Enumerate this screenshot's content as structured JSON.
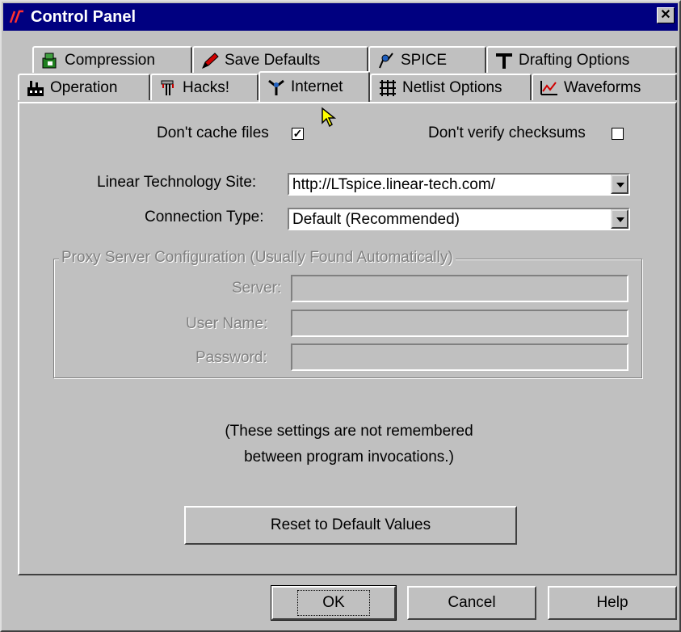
{
  "window": {
    "title": "Control Panel",
    "close_glyph": "✕"
  },
  "tabs_row1": [
    {
      "label": "Compression",
      "icon": "compression-icon"
    },
    {
      "label": "Save Defaults",
      "icon": "pencil-icon"
    },
    {
      "label": "SPICE",
      "icon": "spice-icon"
    },
    {
      "label": "Drafting Options",
      "icon": "drafting-icon"
    }
  ],
  "tabs_row2": [
    {
      "label": "Operation",
      "icon": "factory-icon"
    },
    {
      "label": "Hacks!",
      "icon": "hacks-icon"
    },
    {
      "label": "Internet",
      "icon": "antenna-icon",
      "active": true
    },
    {
      "label": "Netlist Options",
      "icon": "grid-icon"
    },
    {
      "label": "Waveforms",
      "icon": "waveform-icon"
    }
  ],
  "internet": {
    "dont_cache_label": "Don't cache files",
    "dont_cache_checked": true,
    "check_mark": "✓",
    "dont_verify_label": "Don't verify checksums",
    "dont_verify_checked": false,
    "site_label": "Linear Technology Site:",
    "site_value": "http://LTspice.linear-tech.com/",
    "connection_label": "Connection Type:",
    "connection_value": "Default (Recommended)",
    "proxy_group_title": "Proxy Server Configuration (Usually Found Automatically)",
    "server_label": "Server:",
    "username_label": "User Name:",
    "password_label": "Password:",
    "note_line1": "(These settings are not remembered",
    "note_line2": "between program invocations.)",
    "reset_button": "Reset to Default Values"
  },
  "footer": {
    "ok": "OK",
    "cancel": "Cancel",
    "help": "Help"
  },
  "colors": {
    "titlebar": "#000080",
    "face": "#c0c0c0",
    "disabled_text": "#808080"
  }
}
